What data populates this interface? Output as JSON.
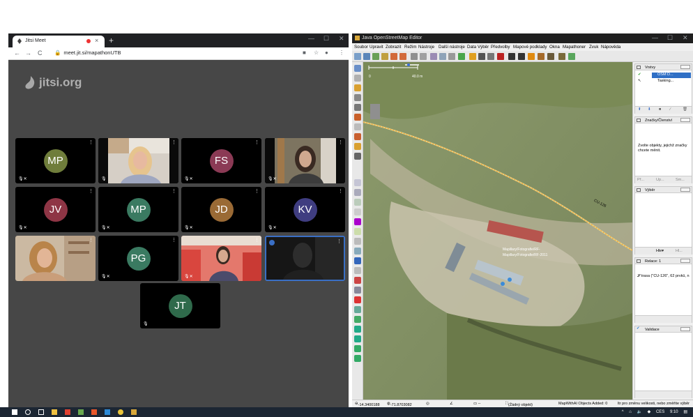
{
  "chrome": {
    "tab_title": "Jitsi Meet",
    "tab_close": "×",
    "new_tab": "+",
    "url": "meet.jit.si/mapathonUTB",
    "back": "←",
    "forward": "→",
    "reload": "C",
    "star": "☆",
    "menu": "⋮",
    "minimize": "—",
    "maximize": "☐",
    "close": "✕"
  },
  "jitsi": {
    "logo_text": "jitsi.org",
    "participants": [
      {
        "initials": "MP",
        "color": "#6f7d3b",
        "has_video": false,
        "muted": true
      },
      {
        "initials": "",
        "color": "#000000",
        "has_video": true,
        "muted": true
      },
      {
        "initials": "FS",
        "color": "#8b3a55",
        "has_video": false,
        "muted": true
      },
      {
        "initials": "",
        "color": "#000000",
        "has_video": true,
        "muted": true
      },
      {
        "initials": "JV",
        "color": "#8e3545",
        "has_video": false,
        "muted": true
      },
      {
        "initials": "MP",
        "color": "#3a7a61",
        "has_video": false,
        "muted": true
      },
      {
        "initials": "JD",
        "color": "#9a6a35",
        "has_video": false,
        "muted": true
      },
      {
        "initials": "KV",
        "color": "#3f3d80",
        "has_video": false,
        "muted": true
      },
      {
        "initials": "",
        "color": "#000000",
        "has_video": true,
        "muted": false
      },
      {
        "initials": "PG",
        "color": "#3a7a61",
        "has_video": false,
        "muted": true
      },
      {
        "initials": "",
        "color": "#000000",
        "has_video": true,
        "muted": true
      },
      {
        "initials": "",
        "color": "#000000",
        "has_video": true,
        "muted": false,
        "active": true
      },
      {
        "initials": "JT",
        "color": "#2f6a4b",
        "has_video": false,
        "muted": false
      }
    ],
    "mute_glyph": "🎙 ✖"
  },
  "josm": {
    "title": "Java OpenStreetMap Editor",
    "menu": [
      "Soubor",
      "Upravit",
      "Zobrazit",
      "Režim",
      "Nástroje",
      "Další nástroje",
      "Data",
      "Výběr",
      "Předvolby",
      "Mapové podklady",
      "Okna",
      "Mapathoner",
      "Zvuk",
      "Nápověda"
    ],
    "scale_label": "40.0 m",
    "scale_zero": "0",
    "road_label": "CU-126",
    "map_label_1": "Mapillary/Fotografie/RF-",
    "map_label_2": "Mapillary/Fotografie/RF-2011",
    "panels": {
      "layers": {
        "title": "Vrstvy",
        "items": [
          "OSM D...",
          "Tasking..."
        ]
      },
      "tags": {
        "title": "Značky/Členství",
        "message": "Zvolte objekty, jejichž značky chcete měnit.",
        "buttons": [
          "Př...",
          "Up...",
          "Sm..."
        ]
      },
      "selection": {
        "title": "Výběr",
        "buttons": [
          "Hle▾",
          "Hl..."
        ]
      },
      "relations": {
        "title": "Relace: 1",
        "item": "trasa (\"CU-126\", 62 prvků, n"
      },
      "validation": {
        "title": "Validace"
      }
    },
    "status": {
      "lat": "-14.3400188",
      "lon": "-71.8703082",
      "selection": "(Žádný objekt)",
      "plugin": "MapWithAI Objects Added: 0",
      "hint": "ltr pro změnu velikosti, nebo změňte výběr"
    }
  },
  "taskbar": {
    "tray_lang": "CES",
    "clock": "9:10"
  }
}
